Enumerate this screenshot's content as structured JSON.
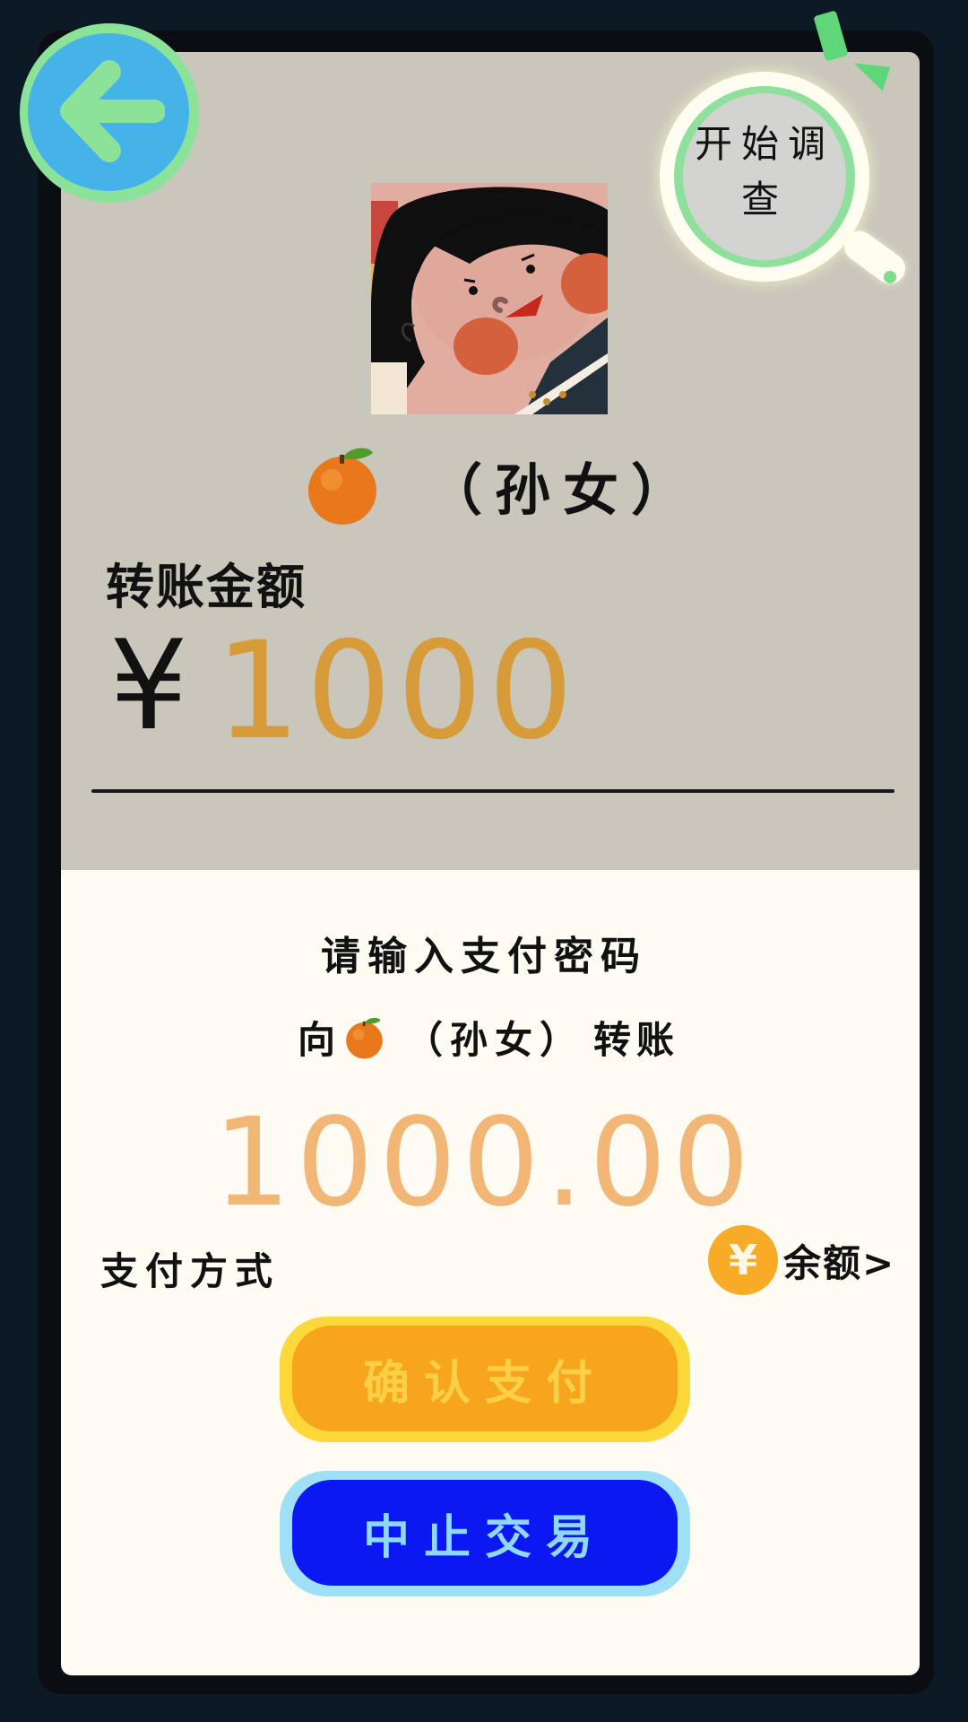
{
  "header": {
    "back_icon": "arrow-left-icon",
    "investigate_label": "开始调查",
    "investigate_icon": "magnifier-icon"
  },
  "recipient": {
    "emoji": "🍊",
    "name": "（孙女）"
  },
  "transfer": {
    "amount_label": "转账金额",
    "currency_symbol": "¥",
    "amount": "1000"
  },
  "payment_sheet": {
    "title": "请输入支付密码",
    "to_prefix": "向",
    "to_name": "（孙女）",
    "to_suffix": "转账",
    "amount": "1000.00",
    "method_label": "支付方式",
    "method_coin": "¥",
    "method_value": "余额>",
    "confirm_label": "确认支付",
    "abort_label": "中止交易"
  },
  "colors": {
    "back_button": "#45b3e8",
    "accent_green": "#8be39a",
    "amount_input": "#d79b3a",
    "pay_amount": "#f2b677",
    "confirm_button": "#f7a51d",
    "abort_button": "#0b18f2"
  }
}
